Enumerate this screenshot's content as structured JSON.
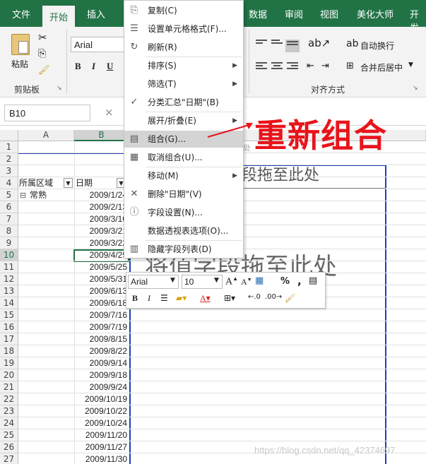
{
  "ribbon": {
    "tabs": [
      {
        "label": "文件"
      },
      {
        "label": "开始"
      },
      {
        "label": "插入"
      },
      {
        "label": "数据"
      },
      {
        "label": "审阅"
      },
      {
        "label": "视图"
      },
      {
        "label": "美化大师"
      },
      {
        "label": "开发"
      }
    ],
    "clipboard": {
      "paste_label": "粘贴",
      "group_label": "剪贴板"
    },
    "font": {
      "name": "Arial",
      "bold": "B",
      "italic": "I",
      "underline": "U"
    },
    "alignment": {
      "wrap_text": "自动换行",
      "merge_center": "合并后居中",
      "group_label": "对齐方式"
    }
  },
  "formula_bar": {
    "name_box": "B10",
    "cancel_icon": "×"
  },
  "sheet": {
    "columns": [
      "A",
      "B"
    ],
    "row_numbers": [
      "1",
      "2",
      "3",
      "4",
      "5",
      "6",
      "7",
      "8",
      "9",
      "10",
      "11",
      "12",
      "13",
      "14",
      "15",
      "16",
      "17",
      "18",
      "19",
      "20",
      "21",
      "22",
      "23",
      "24",
      "25",
      "26",
      "27"
    ],
    "selected_row": "10",
    "pivot": {
      "header_a": "所属区域",
      "header_b": "日期",
      "group_name": "常熟",
      "collapse_icon": "⊟",
      "dates": [
        "2009/1/24",
        "2009/2/13",
        "2009/3/10",
        "2009/3/21",
        "2009/3/22",
        "2009/4/29",
        "2009/5/25",
        "2009/5/31",
        "2009/6/13",
        "2009/6/18",
        "2009/7/16",
        "2009/7/19",
        "2009/8/15",
        "2009/8/22",
        "2009/9/14",
        "2009/9/18",
        "2009/9/24",
        "2009/10/19",
        "2009/10/22",
        "2009/10/24",
        "2009/11/20",
        "2009/11/27",
        "2009/11/30"
      ],
      "drop_col_hint": "段拖至此处",
      "drop_values_hint": "将值字段拖至此处",
      "top_fragment": "处"
    }
  },
  "context_menu": {
    "items": [
      {
        "label": "复制(C)",
        "icon": "copy-icon",
        "glyph": "⎘"
      },
      {
        "label": "设置单元格格式(F)...",
        "icon": "format-cells-icon",
        "glyph": "☰"
      },
      {
        "label": "刷新(R)",
        "icon": "refresh-icon",
        "glyph": "↻"
      },
      {
        "label": "排序(S)",
        "submenu": true
      },
      {
        "label": "筛选(T)",
        "submenu": true
      },
      {
        "label": "分类汇总\"日期\"(B)",
        "icon": "check-icon",
        "glyph": "✓"
      },
      {
        "label": "展开/折叠(E)",
        "submenu": true
      },
      {
        "label": "组合(G)...",
        "icon": "group-icon",
        "glyph": "▤"
      },
      {
        "label": "取消组合(U)...",
        "icon": "ungroup-icon",
        "glyph": "▦"
      },
      {
        "label": "移动(M)",
        "submenu": true
      },
      {
        "label": "删除\"日期\"(V)",
        "icon": "delete-x-icon",
        "glyph": "✕"
      },
      {
        "label": "字段设置(N)...",
        "icon": "field-settings-icon",
        "glyph": "ⓘ"
      },
      {
        "label": "数据透视表选项(O)..."
      },
      {
        "label": "隐藏字段列表(D)",
        "icon": "field-list-icon",
        "glyph": "▥"
      }
    ],
    "highlighted_index": 7
  },
  "mini_toolbar": {
    "font": "Arial",
    "size": "10",
    "percent": "%",
    "comma": ","
  },
  "annotation": {
    "text": "重新组合",
    "color": "#e8141b"
  },
  "watermark": "https://blog.csdn.net/qq_42374697",
  "colors": {
    "excel_green": "#217346",
    "pivot_border": "#1f3fb5"
  }
}
